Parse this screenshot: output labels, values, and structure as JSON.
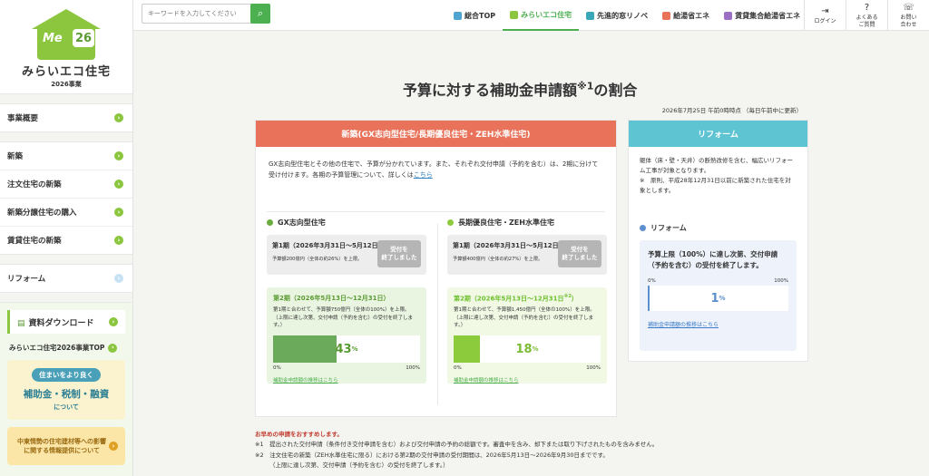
{
  "sidebar": {
    "logo": {
      "me": "Me",
      "num": "26",
      "name": "みらいエコ住宅",
      "year": "2026事業"
    },
    "items": [
      {
        "label": "事業概要"
      },
      {
        "label": "新築"
      },
      {
        "label": "注文住宅の新築"
      },
      {
        "label": "新築分譲住宅の購入"
      },
      {
        "label": "賃貸住宅の新築"
      },
      {
        "label": "リフォーム"
      }
    ],
    "download": {
      "label": "資料ダウンロード",
      "top_link": "みらいエコ住宅2026事業TOP"
    },
    "banner1": {
      "tag": "住まいをより良く",
      "title": "補助金・税制・融資",
      "sub": "について"
    },
    "banner2": {
      "text": "中東情勢の住宅建材等への影響に関する情報提供について"
    }
  },
  "header": {
    "search_placeholder": "キーワードを入力してください",
    "tabs": [
      {
        "label": "総合TOP",
        "color": "#4fa3d1"
      },
      {
        "label": "みらいエコ住宅",
        "color": "#8cc63f"
      },
      {
        "label": "先進的窓リノベ",
        "color": "#3aa7b8"
      },
      {
        "label": "給湯省エネ",
        "color": "#e8725a"
      },
      {
        "label": "賃貸集合給湯省エネ",
        "color": "#9b6fc4"
      }
    ],
    "login": "ログイン",
    "faq_1": "よくある",
    "faq_2": "ご質問",
    "contact_1": "お問い",
    "contact_2": "合わせ"
  },
  "main": {
    "title": "予算に対する補助金申請額",
    "title_sup": "※1",
    "title_tail": "の割合",
    "updated": "2026年7月25日 午前0時時点 （毎日午前中に更新）",
    "new_build": {
      "header": "新築(GX志向型住宅/長期優良住宅・ZEH水準住宅)",
      "intro": "GX志向型住宅とその他の住宅で、予算が分かれています。また、それぞれ交付申請（予約を含む）は、2期に分けて受け付けます。各期の予算管理について、詳しくは",
      "intro_link": "こちら",
      "gx": {
        "title": "GX志向型住宅",
        "p1_title": "第1期（2026年3月31日～5月12日）",
        "p1_sub": "予算額200億円（全体の約26%）を上限。",
        "p1_badge_1": "受付を",
        "p1_badge_2": "終了しました",
        "p2_title": "第2期（2026年5月13日～12月31日）",
        "p2_desc_1": "第1期と合わせて、予算額750億円（全体の100%）を上限。",
        "p2_desc_2": "（上限に達し次第、交付申請（予約を含む）の受付を終了します。）",
        "progress": 43,
        "pct_unit": "%",
        "scale_min": "0%",
        "scale_max": "100%",
        "link": "補助金申請額の推移はこちら"
      },
      "zeh": {
        "title": "長期優良住宅・ZEH水準住宅",
        "p1_title": "第1期（2026年3月31日～5月12日）",
        "p1_sub": "予算額400億円（全体の約27%）を上限。",
        "p1_badge_1": "受付を",
        "p1_badge_2": "終了しました",
        "p2_title": "第2期（2026年5月13日～12月31日",
        "p2_title_sup": "※2",
        "p2_title_tail": "）",
        "p2_desc_1": "第1期と合わせて、予算額1,450億円（全体の100%）を上限。",
        "p2_desc_2": "（上限に達し次第、交付申請（予約を含む）の受付を終了します。）",
        "progress": 18,
        "pct_unit": "%",
        "scale_min": "0%",
        "scale_max": "100%",
        "link": "補助金申請額の推移はこちら"
      }
    },
    "reform": {
      "header": "リフォーム",
      "intro_1": "躯体（床・壁・天井）の断熱改修を含む、幅広いリフォーム工事が対象となります。",
      "intro_2": "※　原則、平成28年12月31日以前に新築された住宅を対象とします。",
      "sub": "リフォーム",
      "box_text": "予算上限（100%）に達し次第、交付申請（予約を含む）の受付を終了します。",
      "progress": 1,
      "pct_unit": "%",
      "scale_min": "0%",
      "scale_max": "100%",
      "link": "補助金申請額の推移はこちら"
    },
    "notes": {
      "head": "お早めの申請をおすすめします。",
      "n1": "※1　提出された交付申請（条件付き交付申請を含む）および交付申請の予約の総額です。審査中を含み、却下または取り下げされたものを含みません。",
      "n2": "※2　注文住宅の新築（ZEH水準住宅に限る）における第2期の交付申請の受付期間は、2026年5月13日～2026年9月30日までです。",
      "n3": "（上限に達し次第、交付申請（予約を含む）の受付を終了します。）"
    }
  }
}
